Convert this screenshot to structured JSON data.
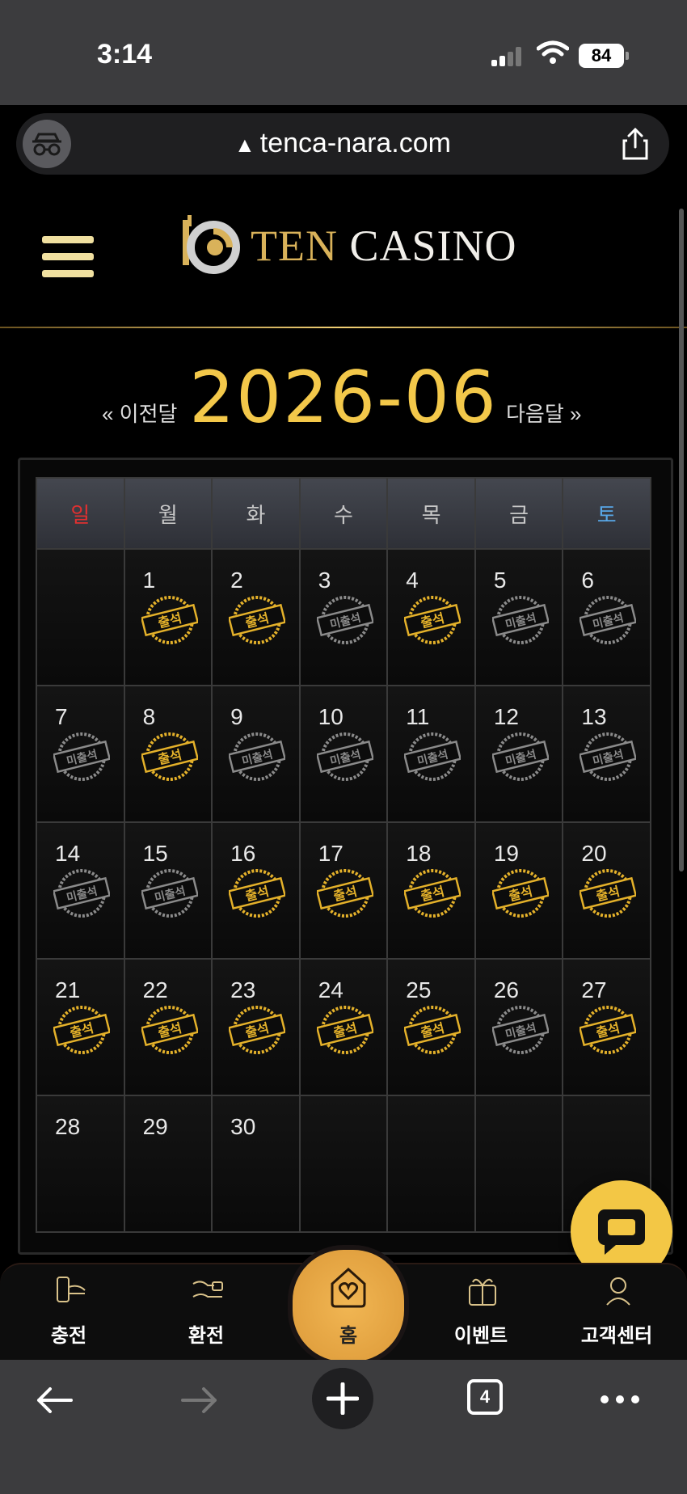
{
  "status_bar": {
    "time": "3:14",
    "battery": "84"
  },
  "browser": {
    "url": "tenca-nara.com",
    "tab_count": "4"
  },
  "header": {
    "logo_part1": "TEN",
    "logo_part2": "CASINO"
  },
  "calendar": {
    "year_month": "2026-06",
    "prev_label": "« 이전달",
    "next_label": "다음달 »",
    "weekdays": [
      "일",
      "월",
      "화",
      "수",
      "목",
      "금",
      "토"
    ],
    "stamp_attended": "출석",
    "stamp_absent": "미출석",
    "days": [
      {
        "day": "",
        "status": "none"
      },
      {
        "day": "1",
        "status": "attended"
      },
      {
        "day": "2",
        "status": "attended"
      },
      {
        "day": "3",
        "status": "absent"
      },
      {
        "day": "4",
        "status": "attended"
      },
      {
        "day": "5",
        "status": "absent"
      },
      {
        "day": "6",
        "status": "absent"
      },
      {
        "day": "7",
        "status": "absent"
      },
      {
        "day": "8",
        "status": "attended"
      },
      {
        "day": "9",
        "status": "absent"
      },
      {
        "day": "10",
        "status": "absent"
      },
      {
        "day": "11",
        "status": "absent"
      },
      {
        "day": "12",
        "status": "absent"
      },
      {
        "day": "13",
        "status": "absent"
      },
      {
        "day": "14",
        "status": "absent"
      },
      {
        "day": "15",
        "status": "absent"
      },
      {
        "day": "16",
        "status": "attended"
      },
      {
        "day": "17",
        "status": "attended"
      },
      {
        "day": "18",
        "status": "attended"
      },
      {
        "day": "19",
        "status": "attended"
      },
      {
        "day": "20",
        "status": "attended"
      },
      {
        "day": "21",
        "status": "attended"
      },
      {
        "day": "22",
        "status": "attended"
      },
      {
        "day": "23",
        "status": "attended"
      },
      {
        "day": "24",
        "status": "attended"
      },
      {
        "day": "25",
        "status": "attended"
      },
      {
        "day": "26",
        "status": "absent"
      },
      {
        "day": "27",
        "status": "attended"
      },
      {
        "day": "28",
        "status": "none"
      },
      {
        "day": "29",
        "status": "none"
      },
      {
        "day": "30",
        "status": "none"
      },
      {
        "day": "",
        "status": "none"
      },
      {
        "day": "",
        "status": "none"
      },
      {
        "day": "",
        "status": "none"
      },
      {
        "day": "",
        "status": "none"
      }
    ]
  },
  "bottom_nav": {
    "charge": "충전",
    "exchange": "환전",
    "home": "홈",
    "event": "이벤트",
    "support": "고객센터"
  },
  "colors": {
    "gold": "#f3c84a",
    "sunday": "#e03030",
    "saturday": "#58a8e8",
    "stamp_gold": "#e4b12a",
    "stamp_gray": "#8a8a8a"
  }
}
